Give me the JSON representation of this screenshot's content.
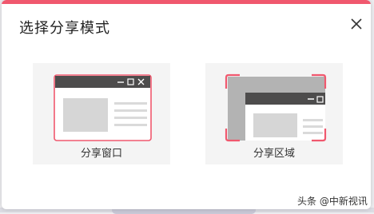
{
  "dialog": {
    "title": "选择分享模式",
    "close_icon": "close-icon"
  },
  "options": [
    {
      "label": "分享窗口",
      "icon": "share-window-illustration"
    },
    {
      "label": "分享区域",
      "icon": "share-region-illustration"
    }
  ],
  "watermark": {
    "text": "头条 @中新视讯"
  },
  "colors": {
    "accent": "#f0586e",
    "titlebar": "#4d4c4c",
    "card_bg": "#f4f4f4"
  }
}
